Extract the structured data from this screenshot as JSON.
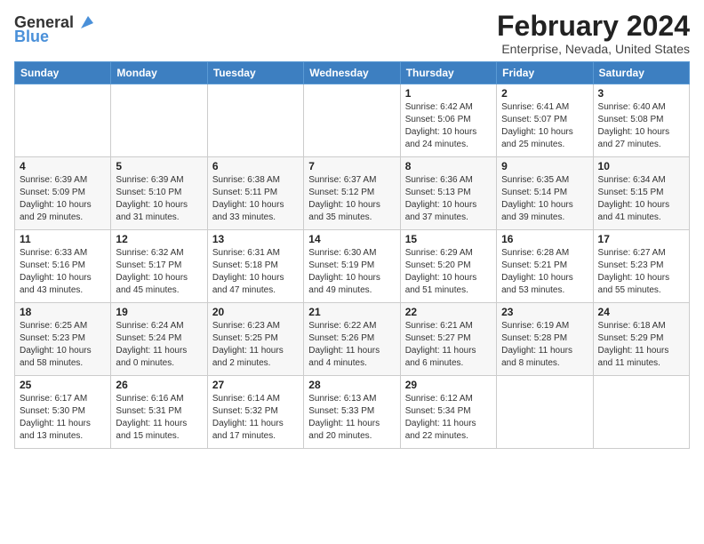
{
  "logo": {
    "line1": "General",
    "line2": "Blue"
  },
  "title": "February 2024",
  "subtitle": "Enterprise, Nevada, United States",
  "days_header": [
    "Sunday",
    "Monday",
    "Tuesday",
    "Wednesday",
    "Thursday",
    "Friday",
    "Saturday"
  ],
  "weeks": [
    [
      {
        "day": "",
        "info": ""
      },
      {
        "day": "",
        "info": ""
      },
      {
        "day": "",
        "info": ""
      },
      {
        "day": "",
        "info": ""
      },
      {
        "day": "1",
        "info": "Sunrise: 6:42 AM\nSunset: 5:06 PM\nDaylight: 10 hours\nand 24 minutes."
      },
      {
        "day": "2",
        "info": "Sunrise: 6:41 AM\nSunset: 5:07 PM\nDaylight: 10 hours\nand 25 minutes."
      },
      {
        "day": "3",
        "info": "Sunrise: 6:40 AM\nSunset: 5:08 PM\nDaylight: 10 hours\nand 27 minutes."
      }
    ],
    [
      {
        "day": "4",
        "info": "Sunrise: 6:39 AM\nSunset: 5:09 PM\nDaylight: 10 hours\nand 29 minutes."
      },
      {
        "day": "5",
        "info": "Sunrise: 6:39 AM\nSunset: 5:10 PM\nDaylight: 10 hours\nand 31 minutes."
      },
      {
        "day": "6",
        "info": "Sunrise: 6:38 AM\nSunset: 5:11 PM\nDaylight: 10 hours\nand 33 minutes."
      },
      {
        "day": "7",
        "info": "Sunrise: 6:37 AM\nSunset: 5:12 PM\nDaylight: 10 hours\nand 35 minutes."
      },
      {
        "day": "8",
        "info": "Sunrise: 6:36 AM\nSunset: 5:13 PM\nDaylight: 10 hours\nand 37 minutes."
      },
      {
        "day": "9",
        "info": "Sunrise: 6:35 AM\nSunset: 5:14 PM\nDaylight: 10 hours\nand 39 minutes."
      },
      {
        "day": "10",
        "info": "Sunrise: 6:34 AM\nSunset: 5:15 PM\nDaylight: 10 hours\nand 41 minutes."
      }
    ],
    [
      {
        "day": "11",
        "info": "Sunrise: 6:33 AM\nSunset: 5:16 PM\nDaylight: 10 hours\nand 43 minutes."
      },
      {
        "day": "12",
        "info": "Sunrise: 6:32 AM\nSunset: 5:17 PM\nDaylight: 10 hours\nand 45 minutes."
      },
      {
        "day": "13",
        "info": "Sunrise: 6:31 AM\nSunset: 5:18 PM\nDaylight: 10 hours\nand 47 minutes."
      },
      {
        "day": "14",
        "info": "Sunrise: 6:30 AM\nSunset: 5:19 PM\nDaylight: 10 hours\nand 49 minutes."
      },
      {
        "day": "15",
        "info": "Sunrise: 6:29 AM\nSunset: 5:20 PM\nDaylight: 10 hours\nand 51 minutes."
      },
      {
        "day": "16",
        "info": "Sunrise: 6:28 AM\nSunset: 5:21 PM\nDaylight: 10 hours\nand 53 minutes."
      },
      {
        "day": "17",
        "info": "Sunrise: 6:27 AM\nSunset: 5:23 PM\nDaylight: 10 hours\nand 55 minutes."
      }
    ],
    [
      {
        "day": "18",
        "info": "Sunrise: 6:25 AM\nSunset: 5:23 PM\nDaylight: 10 hours\nand 58 minutes."
      },
      {
        "day": "19",
        "info": "Sunrise: 6:24 AM\nSunset: 5:24 PM\nDaylight: 11 hours\nand 0 minutes."
      },
      {
        "day": "20",
        "info": "Sunrise: 6:23 AM\nSunset: 5:25 PM\nDaylight: 11 hours\nand 2 minutes."
      },
      {
        "day": "21",
        "info": "Sunrise: 6:22 AM\nSunset: 5:26 PM\nDaylight: 11 hours\nand 4 minutes."
      },
      {
        "day": "22",
        "info": "Sunrise: 6:21 AM\nSunset: 5:27 PM\nDaylight: 11 hours\nand 6 minutes."
      },
      {
        "day": "23",
        "info": "Sunrise: 6:19 AM\nSunset: 5:28 PM\nDaylight: 11 hours\nand 8 minutes."
      },
      {
        "day": "24",
        "info": "Sunrise: 6:18 AM\nSunset: 5:29 PM\nDaylight: 11 hours\nand 11 minutes."
      }
    ],
    [
      {
        "day": "25",
        "info": "Sunrise: 6:17 AM\nSunset: 5:30 PM\nDaylight: 11 hours\nand 13 minutes."
      },
      {
        "day": "26",
        "info": "Sunrise: 6:16 AM\nSunset: 5:31 PM\nDaylight: 11 hours\nand 15 minutes."
      },
      {
        "day": "27",
        "info": "Sunrise: 6:14 AM\nSunset: 5:32 PM\nDaylight: 11 hours\nand 17 minutes."
      },
      {
        "day": "28",
        "info": "Sunrise: 6:13 AM\nSunset: 5:33 PM\nDaylight: 11 hours\nand 20 minutes."
      },
      {
        "day": "29",
        "info": "Sunrise: 6:12 AM\nSunset: 5:34 PM\nDaylight: 11 hours\nand 22 minutes."
      },
      {
        "day": "",
        "info": ""
      },
      {
        "day": "",
        "info": ""
      }
    ]
  ]
}
